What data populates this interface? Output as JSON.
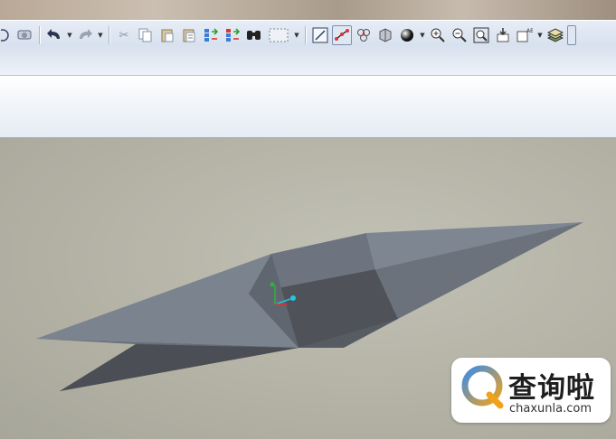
{
  "toolbar": {
    "buttons": [
      {
        "name": "open-file-icon",
        "glyph": "◉"
      },
      {
        "name": "undo-icon",
        "glyph": "↶"
      },
      {
        "name": "redo-icon",
        "glyph": "↷"
      },
      {
        "name": "cut-icon",
        "glyph": "✂"
      },
      {
        "name": "copy-icon",
        "glyph": "⎘"
      },
      {
        "name": "paste-icon",
        "glyph": "📋"
      },
      {
        "name": "paste-special-icon",
        "glyph": "▤"
      },
      {
        "name": "regenerate-icon",
        "glyph": "⇄"
      },
      {
        "name": "regenerate-manager-icon",
        "glyph": "⇆"
      },
      {
        "name": "find-icon",
        "glyph": "⌗"
      },
      {
        "name": "select-box-icon",
        "glyph": "⬚"
      },
      {
        "name": "sketch-icon",
        "glyph": "◪"
      },
      {
        "name": "datum-display-icon",
        "glyph": "⟋"
      },
      {
        "name": "spin-center-icon",
        "glyph": "❂"
      },
      {
        "name": "view-manager-icon",
        "glyph": "◈"
      },
      {
        "name": "shading-icon",
        "glyph": "●"
      },
      {
        "name": "zoom-in-icon",
        "glyph": "⊕"
      },
      {
        "name": "zoom-out-icon",
        "glyph": "⊖"
      },
      {
        "name": "refit-icon",
        "glyph": "⊡"
      },
      {
        "name": "reorient-icon",
        "glyph": "⇩"
      },
      {
        "name": "saved-views-icon",
        "glyph": "▣"
      },
      {
        "name": "layers-icon",
        "glyph": "≋"
      }
    ]
  },
  "colors": {
    "viewport_bg": "#b4b3a6",
    "model_light": "#7c8490",
    "model_dark": "#4e5258",
    "axis_x": "#d83030",
    "axis_y": "#30b040",
    "axis_z": "#20c8e0"
  },
  "watermark": {
    "title": "查询啦",
    "url": "chaxunla.com"
  }
}
